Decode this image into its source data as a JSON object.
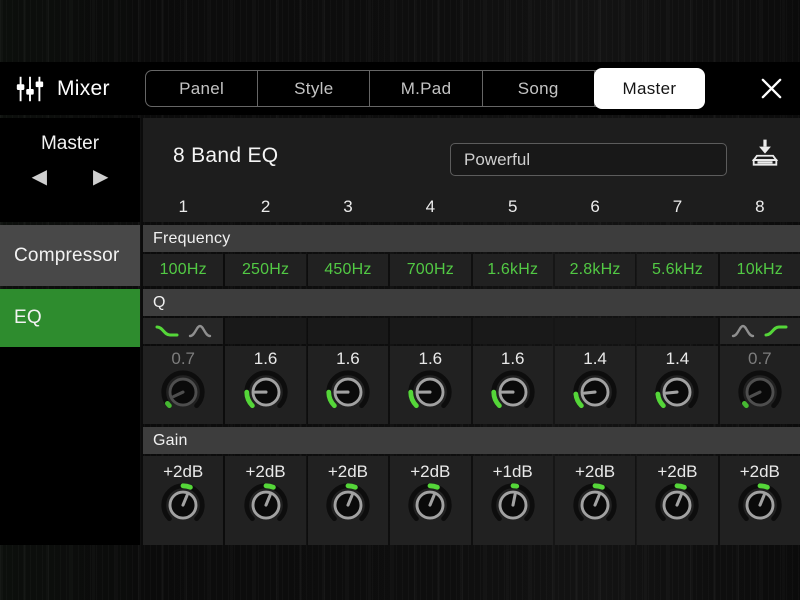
{
  "header": {
    "app_title": "Mixer",
    "tabs": [
      "Panel",
      "Style",
      "M.Pad",
      "Song",
      "Master"
    ],
    "active_tab": "Master"
  },
  "sidebar": {
    "part_name": "Master",
    "prev_label": "◀",
    "next_label": "▶",
    "items": [
      "Compressor",
      "EQ"
    ],
    "active_item": "EQ"
  },
  "eq": {
    "title": "8 Band EQ",
    "preset": "Powerful",
    "row_labels": {
      "frequency": "Frequency",
      "q": "Q",
      "gain": "Gain"
    },
    "bands": [
      {
        "number": "1",
        "frequency": "100Hz",
        "q": "0.7",
        "q_value": 0.7,
        "q_enabled": false,
        "filter_icons": [
          {
            "name": "low-shelf-icon",
            "type": "low-shelf",
            "active": true
          },
          {
            "name": "peak-icon",
            "type": "peak",
            "active": false
          }
        ],
        "gain": "+2dB",
        "gain_value": 2
      },
      {
        "number": "2",
        "frequency": "250Hz",
        "q": "1.6",
        "q_value": 1.6,
        "q_enabled": true,
        "gain": "+2dB",
        "gain_value": 2
      },
      {
        "number": "3",
        "frequency": "450Hz",
        "q": "1.6",
        "q_value": 1.6,
        "q_enabled": true,
        "gain": "+2dB",
        "gain_value": 2
      },
      {
        "number": "4",
        "frequency": "700Hz",
        "q": "1.6",
        "q_value": 1.6,
        "q_enabled": true,
        "gain": "+2dB",
        "gain_value": 2
      },
      {
        "number": "5",
        "frequency": "1.6kHz",
        "q": "1.6",
        "q_value": 1.6,
        "q_enabled": true,
        "gain": "+1dB",
        "gain_value": 1
      },
      {
        "number": "6",
        "frequency": "2.8kHz",
        "q": "1.4",
        "q_value": 1.4,
        "q_enabled": true,
        "gain": "+2dB",
        "gain_value": 2
      },
      {
        "number": "7",
        "frequency": "5.6kHz",
        "q": "1.4",
        "q_value": 1.4,
        "q_enabled": true,
        "gain": "+2dB",
        "gain_value": 2
      },
      {
        "number": "8",
        "frequency": "10kHz",
        "q": "0.7",
        "q_value": 0.7,
        "q_enabled": false,
        "filter_icons": [
          {
            "name": "peak-icon",
            "type": "peak",
            "active": false
          },
          {
            "name": "high-shelf-icon",
            "type": "high-shelf",
            "active": true
          }
        ],
        "gain": "+2dB",
        "gain_value": 2
      }
    ]
  },
  "icons": {
    "app": "mixer-faders-icon",
    "close": "close-icon",
    "save": "save-preset-icon",
    "prev": "left-arrow-icon",
    "next": "right-arrow-icon",
    "band1_filter_active": "low-shelf-icon",
    "band8_filter_active": "high-shelf-icon",
    "inactive_filter": "peak-icon"
  },
  "colors": {
    "sidebar_active_green": "#2e8c2e",
    "frequency_value_green": "#52c944",
    "knob_indicator_green": "#55d639",
    "active_tab_bg": "#ffffff"
  }
}
